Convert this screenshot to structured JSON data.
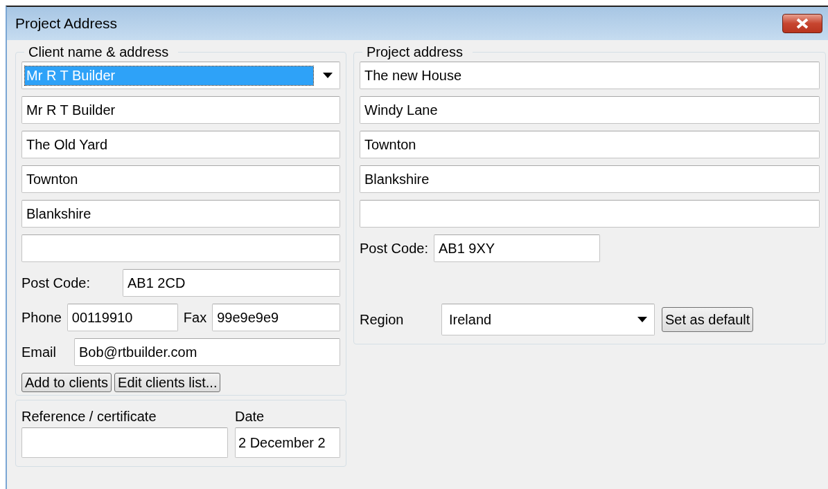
{
  "window": {
    "title": "Project Address"
  },
  "client": {
    "legend": "Client name & address",
    "name_select": {
      "value": "Mr R T Builder",
      "selected": true
    },
    "lines": [
      {
        "kind": "filled",
        "value": "Mr R T Builder"
      },
      {
        "kind": "filled",
        "value": "The Old Yard"
      },
      {
        "kind": "filled",
        "value": "Townton"
      },
      {
        "kind": "filled",
        "value": "Blankshire"
      },
      {
        "kind": "empty"
      }
    ],
    "post_code": {
      "label": "Post Code:",
      "value": "AB1 2CD"
    },
    "phone": {
      "label": "Phone",
      "value": "00119910"
    },
    "fax": {
      "label": "Fax",
      "value": "99e9e9e9"
    },
    "email": {
      "label": "Email",
      "value": "Bob@rtbuilder.com"
    },
    "buttons": [
      "Add to clients",
      "Edit clients list..."
    ]
  },
  "reference": {
    "label": "Reference / certificate"
  },
  "date": {
    "label": "Date",
    "value": "2 December 2"
  },
  "project": {
    "legend": "Project address",
    "lines": [
      {
        "kind": "filled",
        "value": "The new House"
      },
      {
        "kind": "filled",
        "value": "Windy Lane"
      },
      {
        "kind": "filled",
        "value": "Townton"
      },
      {
        "kind": "filled",
        "value": "Blankshire"
      },
      {
        "kind": "empty"
      }
    ],
    "post_code": {
      "label": "Post Code:",
      "value": "AB1 9XY"
    },
    "region": {
      "label": "Region",
      "value": "Ireland"
    },
    "default_button": "Set as default"
  }
}
